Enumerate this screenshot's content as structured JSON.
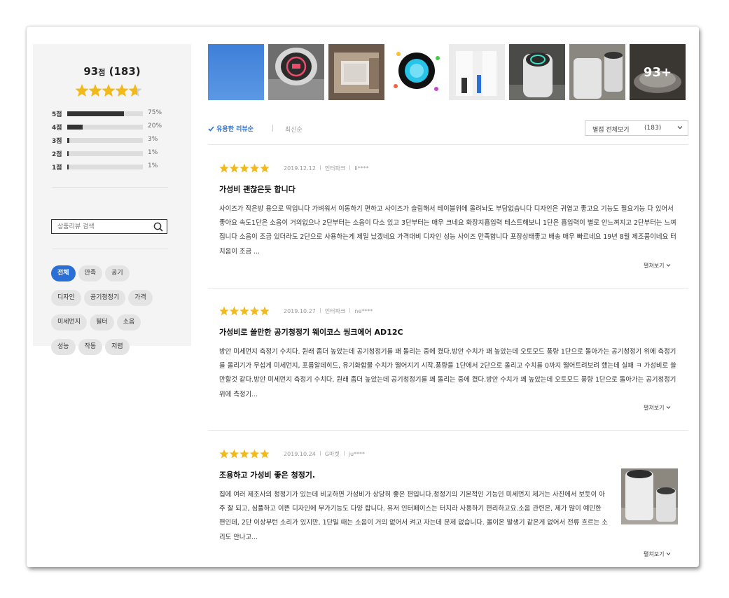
{
  "summary": {
    "score": "93",
    "score_unit": "점",
    "count": "(183)",
    "star_rating": 4.65,
    "distribution": [
      {
        "label": "5점",
        "pct_text": "75%",
        "fraction": 0.75
      },
      {
        "label": "4점",
        "pct_text": "20%",
        "fraction": 0.2
      },
      {
        "label": "3점",
        "pct_text": "3%",
        "fraction": 0.03
      },
      {
        "label": "2점",
        "pct_text": "1%",
        "fraction": 0.01
      },
      {
        "label": "1점",
        "pct_text": "1%",
        "fraction": 0.01
      }
    ],
    "search_placeholder": "상품리뷰 검색",
    "tags": [
      "전체",
      "만족",
      "공기",
      "디자인",
      "공기청정기",
      "가격",
      "미세먼지",
      "필터",
      "소음",
      "성능",
      "작동",
      "저렴"
    ]
  },
  "photos": {
    "more_label": "93+"
  },
  "sort": {
    "helpful": "유용한 리뷰순",
    "latest": "최신순",
    "filter_label": "별점 전체보기",
    "filter_count": "(183)"
  },
  "reviews": [
    {
      "stars": 5,
      "date": "2019.12.12",
      "source": "인터파크",
      "user": "li****",
      "title": "가성비 괜찮은듯 합니다",
      "body": "사이즈가 작은방 용으로 딱입니다 가벼워서 이동하기 편하고 사이즈가 슬림해서 테이블위에 올려놔도 부담없습니다 디자인은 귀엽고 좋고요 기능도 필요기능 다 있어서 좋아요 속도1단은 소음이 거의없으나 2단부터는 소음이 다소 있고 3단부터는 매우 크네요 화장지흡입력 테스트해보니 1단은 흡입력이 별로 안느껴지고 2단부터는 느껴집니다 소음이 조금 있더라도 2단으로 사용하는게 제일 났겠네요 가격대비 디자인 성능 사이즈 만족합니다 포장상태좋고 배송 매우 빠르네요 19년 8월 제조품이네요 터치음이 조금 ...",
      "more": "펼쳐보기"
    },
    {
      "stars": 5,
      "date": "2019.10.27",
      "source": "인터파크",
      "user": "ne****",
      "title": "가성비로 쓸만한 공기청정기 웨이코스 씽크에어 AD12C",
      "body": "방안 미세먼지 측정기 수치다. 원래 좀더 높았는데 공기청정기를 꽤 돌리는 중에 켰다.방안 수치가 꽤 높았는데 오토모드 풍량 1단으로 돌아가는 공기청정기 위에 측정기를 올리기가 무섭게 미세먼지, 포름알데히드, 유기화합물 수치가 떨어지기 시작.풍량을 1단에서 2단으로 올리고 수치를 0까지 떨어트려보려 했는데 실패 ㅋ 가성비로 쓸만할것 같다.방안 미세먼지 측정기 수치다. 원래 좀더 높았는데 공기청정기를 꽤 돌리는 중에 켰다.방안 수치가 꽤 높았는데 오토모드 풍량 1단으로 돌아가는 공기청정기 위에 측정기...",
      "more": "펼쳐보기"
    },
    {
      "stars": 5,
      "date": "2019.10.24",
      "source": "G마켓",
      "user": "ju****",
      "title": "조용하고 가성비 좋은 청정기.",
      "body": "집에 여러 제조사의 청정기가 있는데 비교하면 가성비가 상당히 좋은 편입니다.청정기의 기본적인 기능인 미세먼지 제거는 사진에서 보듯이 아주 잘 되고, 심플하고 이쁜 디자인에 부가기능도 다양 합니다. 유저 인터페이스는 터치라 사용하기 편리하고요.소음 관련은, 제가 많이 예민한 편인데, 2단 이상부턴 소리가 있지만, 1단일 때는 소음이 거의 없어서 켜고 자는데 문제 없습니다. 올이온 발생기 같은게 없어서 전류 흐르는 소리도 안나고...",
      "more": "펼쳐보기"
    }
  ]
}
